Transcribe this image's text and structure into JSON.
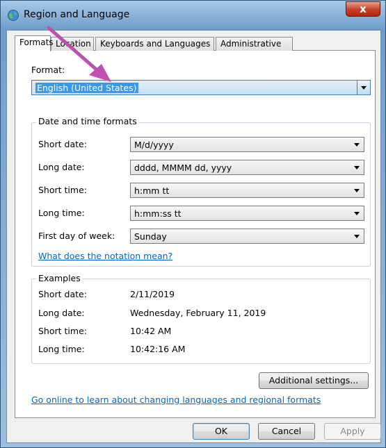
{
  "window": {
    "title": "Region and Language",
    "close_glyph": "x"
  },
  "tabs": [
    {
      "label": "Formats",
      "active": true
    },
    {
      "label": "Location",
      "active": false
    },
    {
      "label": "Keyboards and Languages",
      "active": false
    },
    {
      "label": "Administrative",
      "active": false
    }
  ],
  "format": {
    "label": "Format:",
    "value": "English (United States)"
  },
  "date_time": {
    "group_title": "Date and time formats",
    "rows": [
      {
        "label": "Short date:",
        "value": "M/d/yyyy"
      },
      {
        "label": "Long date:",
        "value": "dddd, MMMM dd, yyyy"
      },
      {
        "label": "Short time:",
        "value": "h:mm tt"
      },
      {
        "label": "Long time:",
        "value": "h:mm:ss tt"
      },
      {
        "label": "First day of week:",
        "value": "Sunday"
      }
    ],
    "notation_link": "What does the notation mean?"
  },
  "examples": {
    "group_title": "Examples",
    "rows": [
      {
        "label": "Short date:",
        "value": "2/11/2019"
      },
      {
        "label": "Long date:",
        "value": "Wednesday, February 11, 2019"
      },
      {
        "label": "Short time:",
        "value": "10:42 AM"
      },
      {
        "label": "Long time:",
        "value": "10:42:16 AM"
      }
    ]
  },
  "additional_settings_label": "Additional settings...",
  "online_link": "Go online to learn about changing languages and regional formats",
  "buttons": {
    "ok": "OK",
    "cancel": "Cancel",
    "apply": "Apply"
  },
  "colors": {
    "annotation_arrow": "#c04fb0",
    "link": "#0066cc",
    "selection": "#3399ff"
  },
  "icons": {
    "window_icon": "globe-icon",
    "annotation": "pointer-arrow-icon"
  }
}
